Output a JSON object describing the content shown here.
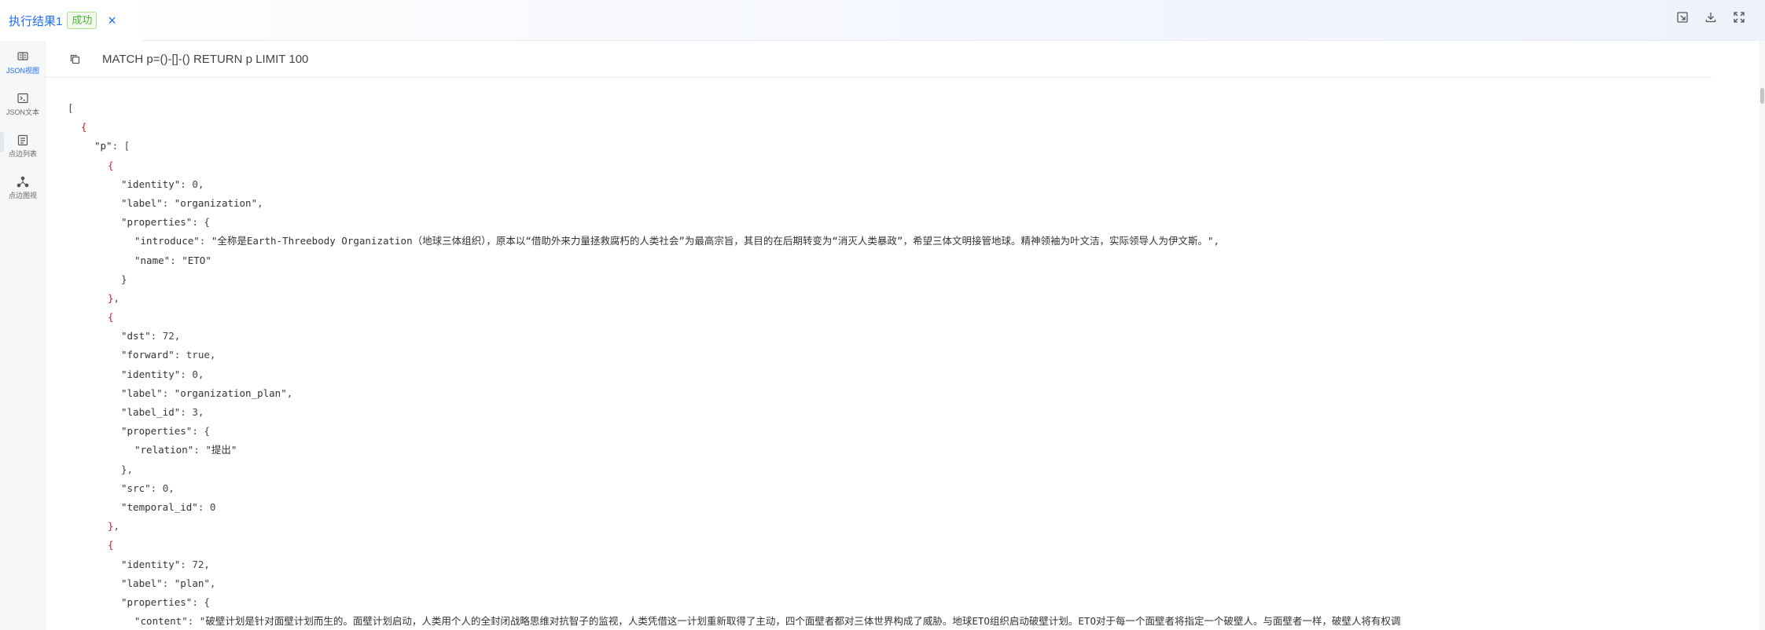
{
  "tab": {
    "title": "执行结果1",
    "status": "成功",
    "close_label": "×"
  },
  "toolbar_icons": [
    "pin-icon",
    "download-icon",
    "fullscreen-icon"
  ],
  "sidebar": {
    "items": [
      {
        "label": "JSON视图",
        "icon": "json-view-icon"
      },
      {
        "label": "JSON文本",
        "icon": "json-text-icon"
      },
      {
        "label": "点边列表",
        "icon": "list-icon"
      },
      {
        "label": "点边图视",
        "icon": "graph-icon"
      }
    ]
  },
  "query": {
    "text": "MATCH p=()-[]-() RETURN p LIMIT 100"
  },
  "json_lines": [
    {
      "indent": 0,
      "parts": [
        [
          "p",
          "["
        ]
      ]
    },
    {
      "indent": 1,
      "parts": [
        [
          "b",
          "{"
        ]
      ]
    },
    {
      "indent": 2,
      "parts": [
        [
          "k",
          "\"p\""
        ],
        [
          "p",
          ": ["
        ]
      ]
    },
    {
      "indent": 3,
      "parts": [
        [
          "b",
          "{"
        ]
      ]
    },
    {
      "indent": 4,
      "parts": [
        [
          "k",
          "\"identity\""
        ],
        [
          "p",
          ": 0,"
        ]
      ]
    },
    {
      "indent": 4,
      "parts": [
        [
          "k",
          "\"label\""
        ],
        [
          "p",
          ": "
        ],
        [
          "s",
          "\"organization\""
        ],
        [
          "p",
          ","
        ]
      ]
    },
    {
      "indent": 4,
      "parts": [
        [
          "k",
          "\"properties\""
        ],
        [
          "p",
          ": {"
        ]
      ]
    },
    {
      "indent": 5,
      "parts": [
        [
          "k",
          "\"introduce\""
        ],
        [
          "p",
          ": "
        ],
        [
          "s",
          "\"全称是Earth-Threebody Organization（地球三体组织），原本以“借助外来力量拯救腐朽的人类社会”为最高宗旨，其目的在后期转变为“消灭人类暴政”，希望三体文明接管地球。精神领袖为叶文洁，实际领导人为伊文斯。\""
        ],
        [
          "p",
          ","
        ]
      ]
    },
    {
      "indent": 5,
      "parts": [
        [
          "k",
          "\"name\""
        ],
        [
          "p",
          ": "
        ],
        [
          "s",
          "\"ETO\""
        ]
      ]
    },
    {
      "indent": 4,
      "parts": [
        [
          "p",
          "}"
        ]
      ]
    },
    {
      "indent": 3,
      "parts": [
        [
          "b",
          "}"
        ],
        [
          "p",
          ","
        ]
      ]
    },
    {
      "indent": 3,
      "parts": [
        [
          "b",
          "{"
        ]
      ]
    },
    {
      "indent": 4,
      "parts": [
        [
          "k",
          "\"dst\""
        ],
        [
          "p",
          ": 72,"
        ]
      ]
    },
    {
      "indent": 4,
      "parts": [
        [
          "k",
          "\"forward\""
        ],
        [
          "p",
          ": true,"
        ]
      ]
    },
    {
      "indent": 4,
      "parts": [
        [
          "k",
          "\"identity\""
        ],
        [
          "p",
          ": 0,"
        ]
      ]
    },
    {
      "indent": 4,
      "parts": [
        [
          "k",
          "\"label\""
        ],
        [
          "p",
          ": "
        ],
        [
          "s",
          "\"organization_plan\""
        ],
        [
          "p",
          ","
        ]
      ]
    },
    {
      "indent": 4,
      "parts": [
        [
          "k",
          "\"label_id\""
        ],
        [
          "p",
          ": 3,"
        ]
      ]
    },
    {
      "indent": 4,
      "parts": [
        [
          "k",
          "\"properties\""
        ],
        [
          "p",
          ": {"
        ]
      ]
    },
    {
      "indent": 5,
      "parts": [
        [
          "k",
          "\"relation\""
        ],
        [
          "p",
          ": "
        ],
        [
          "s",
          "\"提出\""
        ]
      ]
    },
    {
      "indent": 4,
      "parts": [
        [
          "p",
          "},"
        ]
      ]
    },
    {
      "indent": 4,
      "parts": [
        [
          "k",
          "\"src\""
        ],
        [
          "p",
          ": 0,"
        ]
      ]
    },
    {
      "indent": 4,
      "parts": [
        [
          "k",
          "\"temporal_id\""
        ],
        [
          "p",
          ": 0"
        ]
      ]
    },
    {
      "indent": 3,
      "parts": [
        [
          "b",
          "}"
        ],
        [
          "p",
          ","
        ]
      ]
    },
    {
      "indent": 3,
      "parts": [
        [
          "b",
          "{"
        ]
      ]
    },
    {
      "indent": 4,
      "parts": [
        [
          "k",
          "\"identity\""
        ],
        [
          "p",
          ": 72,"
        ]
      ]
    },
    {
      "indent": 4,
      "parts": [
        [
          "k",
          "\"label\""
        ],
        [
          "p",
          ": "
        ],
        [
          "s",
          "\"plan\""
        ],
        [
          "p",
          ","
        ]
      ]
    },
    {
      "indent": 4,
      "parts": [
        [
          "k",
          "\"properties\""
        ],
        [
          "p",
          ": {"
        ]
      ]
    },
    {
      "indent": 5,
      "parts": [
        [
          "k",
          "\"content\""
        ],
        [
          "p",
          ": "
        ],
        [
          "s",
          "\"破壁计划是针对面壁计划而生的。面壁计划启动，人类用个人的全封闭战略思维对抗智子的监视，人类凭借这一计划重新取得了主动，四个面壁者都对三体世界构成了威胁。地球ETO组织启动破壁计划。ETO对于每一个面壁者将指定一个破壁人。与面壁者一样，破壁人将有权调"
        ]
      ]
    }
  ]
}
